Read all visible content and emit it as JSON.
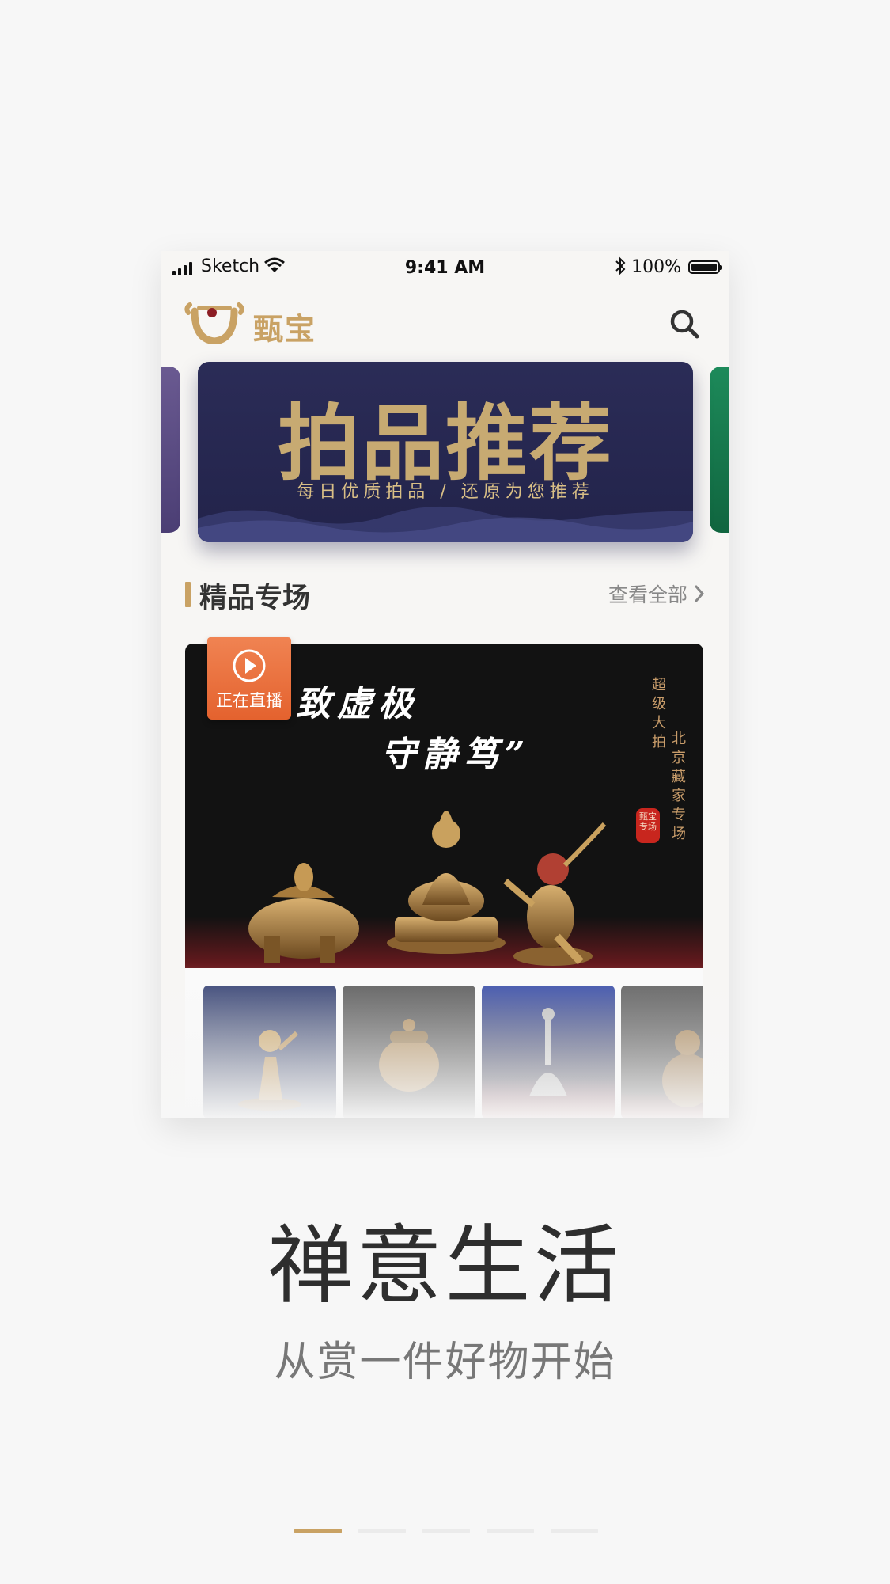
{
  "status_bar": {
    "carrier": "Sketch",
    "time": "9:41 AM",
    "battery_percent": "100%"
  },
  "app": {
    "logo_text": "甄宝",
    "brand_color": "#c9a264"
  },
  "banner": {
    "title": "拍品推荐",
    "subtitle": "每日优质拍品 / 还原为您推荐"
  },
  "section": {
    "title": "精品专场",
    "more_label": "查看全部"
  },
  "feature": {
    "poem_line_1": "致虚极",
    "poem_line_2": "守静笃”",
    "vertical_left": "超级大拍",
    "vertical_right": "北京藏家专场",
    "seal_text": "甄宝专场",
    "live_label": "正在直播",
    "live_color": "#e96a38"
  },
  "onboarding": {
    "headline": "禅意生活",
    "tagline": "从赏一件好物开始",
    "pages": [
      {
        "active": true
      },
      {
        "active": false
      },
      {
        "active": false
      },
      {
        "active": false
      },
      {
        "active": false
      }
    ]
  }
}
